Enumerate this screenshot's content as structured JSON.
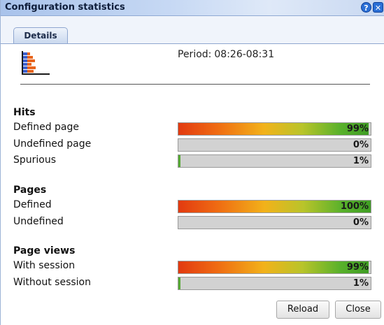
{
  "window": {
    "title": "Configuration statistics"
  },
  "tabs": [
    {
      "label": "Details"
    }
  ],
  "period": {
    "label": "Period:",
    "value": "08:26-08:31"
  },
  "groups": [
    {
      "title": "Hits",
      "rows": [
        {
          "label": "Defined page",
          "value": "99%",
          "percent": 99
        },
        {
          "label": "Undefined page",
          "value": "0%",
          "percent": 0
        },
        {
          "label": "Spurious",
          "value": "1%",
          "percent": 1
        }
      ]
    },
    {
      "title": "Pages",
      "rows": [
        {
          "label": "Defined",
          "value": "100%",
          "percent": 100
        },
        {
          "label": "Undefined",
          "value": "0%",
          "percent": 0
        }
      ]
    },
    {
      "title": "Page views",
      "rows": [
        {
          "label": "With session",
          "value": "99%",
          "percent": 99
        },
        {
          "label": "Without session",
          "value": "1%",
          "percent": 1
        }
      ]
    }
  ],
  "buttons": {
    "reload": "Reload",
    "close": "Close"
  },
  "icons": {
    "help": "help-icon",
    "close": "close-icon",
    "stats": "bar-chart-icon"
  },
  "colors": {
    "bar_start": "#e23a10",
    "bar_mid": "#f2b21a",
    "bar_end": "#3f9d24",
    "bar_track": "#d2d2d2"
  }
}
